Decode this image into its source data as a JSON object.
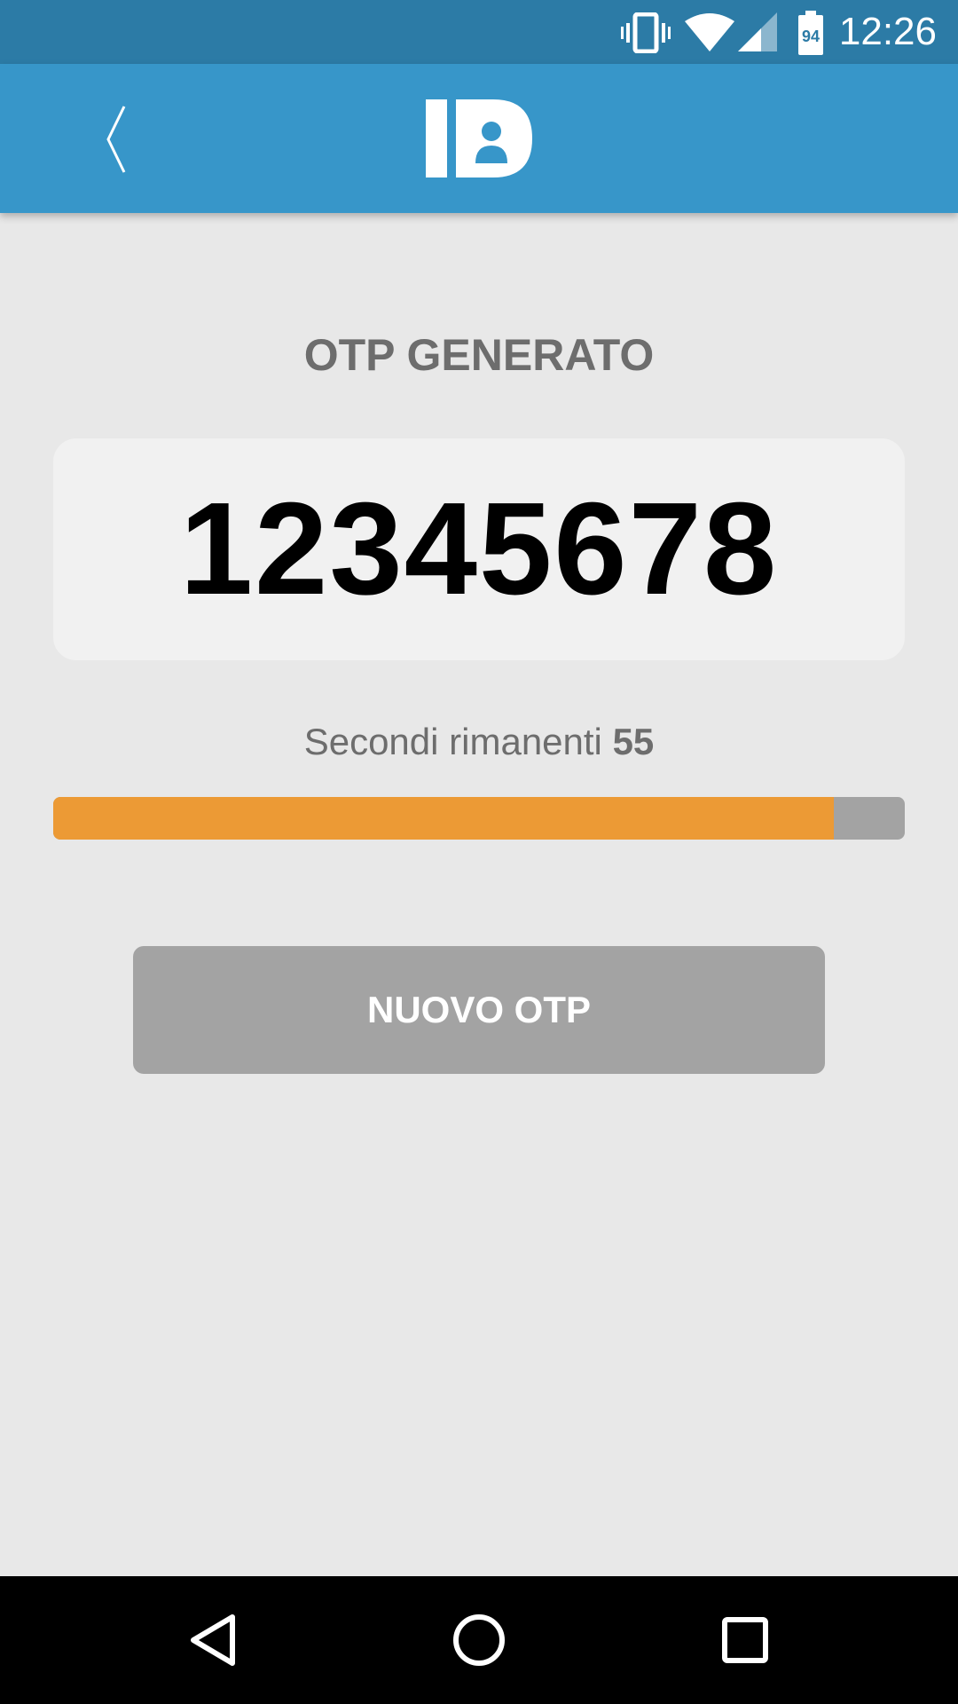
{
  "status_bar": {
    "time": "12:26",
    "battery_level": "94",
    "icons": [
      "vibrate-icon",
      "wifi-icon",
      "signal-icon",
      "battery-icon"
    ]
  },
  "app_bar": {
    "back_icon": "chevron-left-icon",
    "logo_text": "ID"
  },
  "main": {
    "title": "OTP GENERATO",
    "otp_code": "12345678",
    "countdown_label": "Secondi rimanenti",
    "countdown_seconds": "55",
    "progress_fraction": 0.917,
    "new_otp_button": "NUOVO OTP"
  },
  "colors": {
    "status_bar": "#2c7ba6",
    "app_bar": "#3796c9",
    "background": "#e8e8e8",
    "progress_fill": "#ec9a35",
    "progress_track": "#a3a3a3",
    "button": "#a3a3a3"
  },
  "nav_bar": {
    "icons": [
      "back-triangle-icon",
      "home-circle-icon",
      "recents-square-icon"
    ]
  }
}
